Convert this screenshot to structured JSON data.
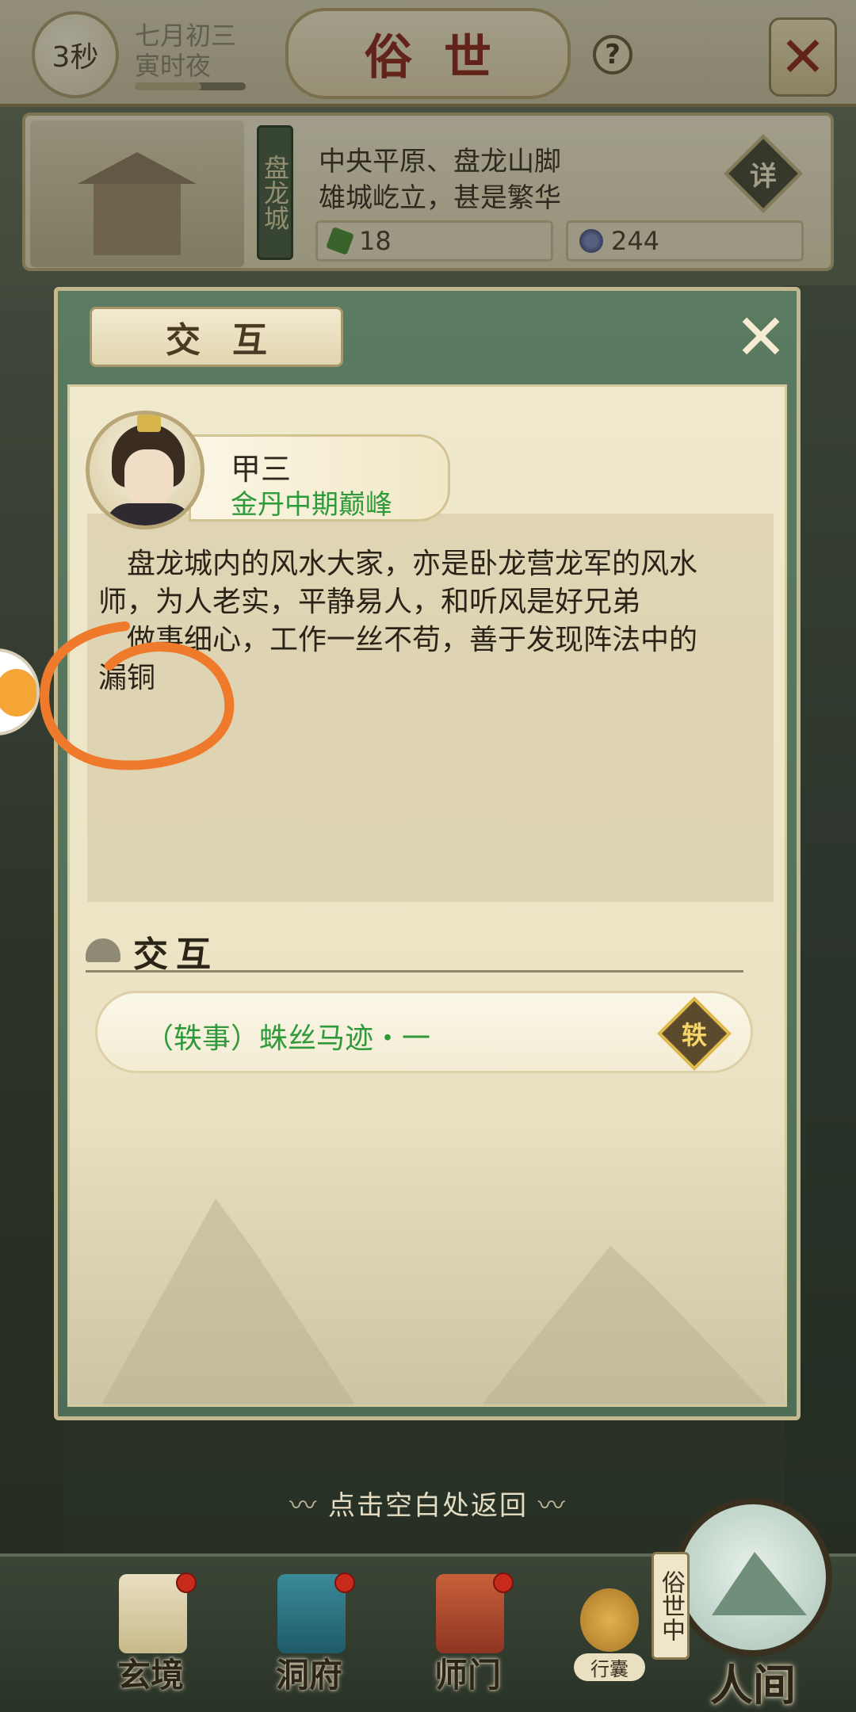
{
  "top_bar": {
    "timer": "3秒",
    "date_line1": "七月初三",
    "date_line2": "寅时夜",
    "time_progress": 0.6,
    "title": "俗世",
    "help_icon": "question-icon",
    "map_icon": "crossed-swords-icon"
  },
  "location": {
    "city_name": "盘龙城",
    "desc_line1": "中央平原、盘龙山脚",
    "desc_line2": "雄城屹立，甚是繁华",
    "detail_label": "详",
    "jade_count": "18",
    "coin_count": "244"
  },
  "dialog": {
    "title": "交互",
    "close_icon": "close-icon",
    "character": {
      "name": "甲三",
      "rank": "金丹中期巅峰"
    },
    "description_lines": [
      "盘龙城内的风水大家，亦是卧龙营龙军的风水",
      "师，为人老实，平静易人，和听风是好兄弟",
      "做事细心，工作一丝不苟，善于发现阵法中的",
      "漏铜"
    ],
    "section_title": "交互",
    "events": [
      {
        "label": "（轶事）蛛丝马迹・一",
        "badge": "轶"
      }
    ]
  },
  "return_hint": "点击空白处返回",
  "bottom_nav": {
    "items": [
      {
        "label": "玄境",
        "has_dot": true
      },
      {
        "label": "洞府",
        "has_dot": true
      },
      {
        "label": "师门",
        "has_dot": true
      }
    ],
    "bag_label": "行囊",
    "world_tag": "俗世中",
    "world_label": "人间"
  },
  "colors": {
    "accent_green": "#2f9a3a",
    "title_red": "#8b2a1f",
    "annotation_orange": "#f07a2c"
  }
}
